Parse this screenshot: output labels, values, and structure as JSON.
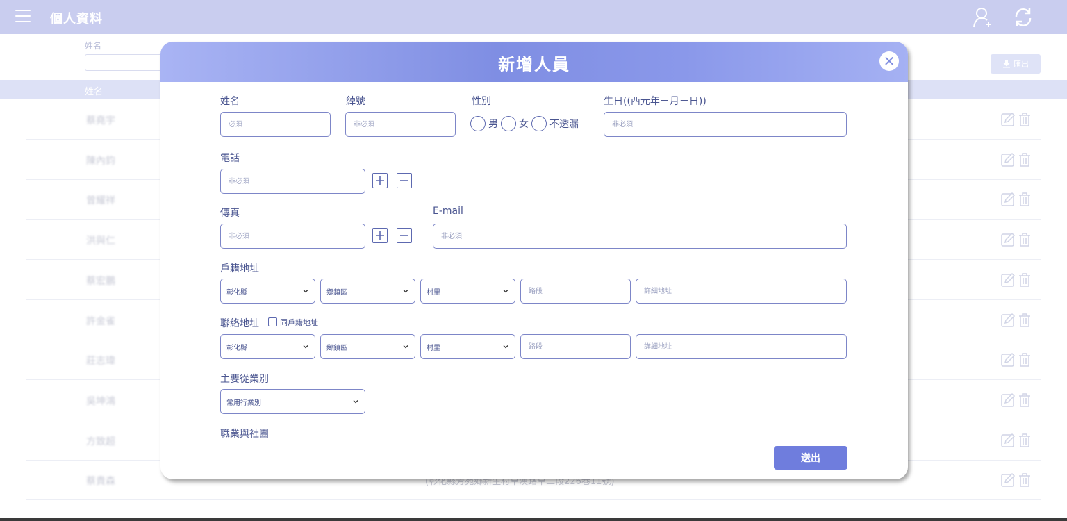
{
  "header": {
    "title": "個人資料"
  },
  "filter": {
    "name_label": "姓名",
    "export_label": "匯出"
  },
  "table": {
    "name_header": "姓名",
    "rows": [
      {
        "name": "蔡堯宇"
      },
      {
        "name": "陳內鈞"
      },
      {
        "name": "曾耀祥"
      },
      {
        "name": "洪與仁"
      },
      {
        "name": "蔡宏鵬"
      },
      {
        "name": "許金雀"
      },
      {
        "name": "莊志瑋"
      },
      {
        "name": "吳坤鴻"
      },
      {
        "name": "方致超"
      },
      {
        "name": "蔡貴森"
      }
    ],
    "bg_address": "(彰化縣芳苑鄉新生村草漢路草二段226巷11號)"
  },
  "modal": {
    "title": "新增人員",
    "fields": {
      "name_label": "姓名",
      "name_placeholder": "必須",
      "nickname_label": "綽號",
      "nickname_placeholder": "非必須",
      "gender_label": "性別",
      "gender_options": [
        "男",
        "女",
        "不透漏"
      ],
      "birthday_label": "生日((西元年－月－日))",
      "birthday_placeholder": "非必須",
      "phone_label": "電話",
      "phone_placeholder": "非必須",
      "fax_label": "傳真",
      "fax_placeholder": "非必須",
      "email_label": "E-mail",
      "email_placeholder": "非必須",
      "household_label": "戶籍地址",
      "household_county": "彰化縣",
      "household_township": "鄉鎮區",
      "household_village": "村里",
      "household_road_placeholder": "路段",
      "household_detail_placeholder": "詳細地址",
      "contact_label": "聯絡地址",
      "same_as_household": "同戶籍地址",
      "contact_county": "彰化縣",
      "contact_township": "鄉鎮區",
      "contact_village": "村里",
      "contact_road_placeholder": "路段",
      "contact_detail_placeholder": "詳細地址",
      "occupation_label": "主要從業別",
      "occupation_value": "常用行業別",
      "groups_label": "職業與社團"
    },
    "submit_label": "送出"
  },
  "colors": {
    "accent": "#6f7ddd",
    "topbar": "#c9cdef",
    "input_border": "#7d86c8"
  }
}
